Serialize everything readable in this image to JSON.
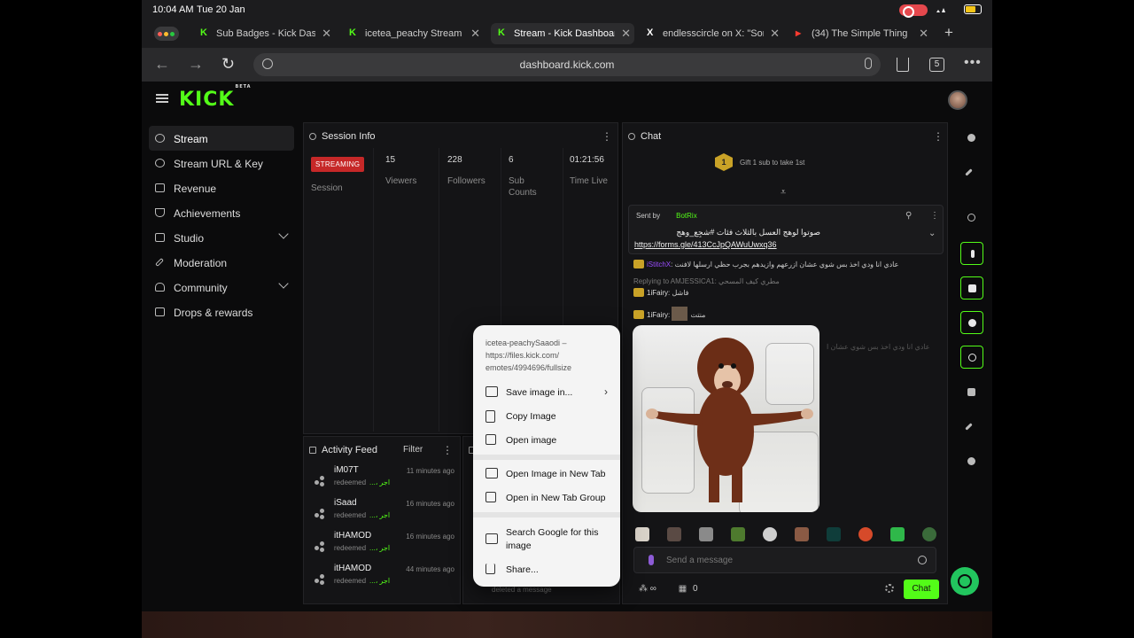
{
  "status": {
    "time": "10:04 AM",
    "date": "Tue 20 Jan"
  },
  "tabs": [
    {
      "title": "Sub Badges - Kick Dash",
      "favicon": "K"
    },
    {
      "title": "icetea_peachy Stream -",
      "favicon": "K"
    },
    {
      "title": "Stream - Kick Dashboar",
      "favicon": "K",
      "active": true
    },
    {
      "title": "endlesscircle on X: \"Sor",
      "favicon": "X"
    },
    {
      "title": "(34) The Simple Thing",
      "favicon": "▶"
    }
  ],
  "browser": {
    "url": "dashboard.kick.com",
    "tab_count": "5"
  },
  "brand": {
    "logo": "KICK",
    "beta": "BETA",
    "accent": "#53fc18"
  },
  "sidebar": {
    "items": [
      {
        "label": "Stream",
        "icon": "broadcast-icon",
        "active": true
      },
      {
        "label": "Stream URL & Key",
        "icon": "link-icon"
      },
      {
        "label": "Revenue",
        "icon": "chart-icon"
      },
      {
        "label": "Achievements",
        "icon": "trophy-icon"
      },
      {
        "label": "Studio",
        "icon": "studio-icon",
        "expandable": true
      },
      {
        "label": "Moderation",
        "icon": "wrench-icon"
      },
      {
        "label": "Community",
        "icon": "community-icon",
        "expandable": true
      },
      {
        "label": "Drops & rewards",
        "icon": "gift-icon"
      }
    ]
  },
  "session": {
    "title": "Session Info",
    "status": "STREAMING",
    "status_label": "Session",
    "stats": [
      {
        "value": "15",
        "label": "Viewers"
      },
      {
        "value": "228",
        "label": "Followers"
      },
      {
        "value": "6",
        "label": "Sub Counts"
      },
      {
        "value": "01:21:56",
        "label": "Time Live"
      }
    ]
  },
  "activity": {
    "title": "Activity Feed",
    "filter": "Filter",
    "items": [
      {
        "name": "iM07T",
        "time": "11 minutes ago",
        "action": "redeemed",
        "reward": "اجر ،‏...‏"
      },
      {
        "name": "iSaad",
        "time": "16 minutes ago",
        "action": "redeemed",
        "reward": "اجر ،‏...‏"
      },
      {
        "name": "itHAMOD",
        "time": "16 minutes ago",
        "action": "redeemed",
        "reward": "اجر ،‏...‏"
      },
      {
        "name": "itHAMOD",
        "time": "44 minutes ago",
        "action": "redeemed",
        "reward": "اجر ،‏...‏"
      }
    ]
  },
  "modlog": {
    "deleted": "deleted a message"
  },
  "chat": {
    "title": "Chat",
    "gift_text": "Gift 1 sub to take 1st",
    "gift_rank": "1",
    "pinned": {
      "sent_by": "Sent by",
      "bot": "BotRix",
      "message": "صوتوا لوهج العسل بالثلاث فئات #شجِع_وهج",
      "link": "https://forms.gle/413CcJpQAWuUwxq36"
    },
    "lines": [
      {
        "user": "iStitchX",
        "text": "عادي انا ودي اخذ بس شوي عشان ازرعهم وازيدهم بجرب حظي ارسلها لافنت"
      },
      {
        "reply": "Replying to AMJESSICA1: مطري كيف المسحي"
      },
      {
        "user": "1iFairy",
        "text": "فاشل"
      },
      {
        "user": "1iFairy",
        "text": "منتت"
      },
      {
        "faded": "عادي انا ودي اخذ بس شوي عشان ا"
      }
    ],
    "input_placeholder": "Send a message",
    "points": "∞",
    "count": "0",
    "send": "Chat"
  },
  "context_menu": {
    "header": "icetea-peachySaaodi – https://files.kick.com/ emotes/4994696/fullsize",
    "groups": [
      [
        {
          "label": "Save image in...",
          "icon": "save-image-icon",
          "submenu": true
        },
        {
          "label": "Copy Image",
          "icon": "copy-icon"
        },
        {
          "label": "Open image",
          "icon": "open-icon"
        }
      ],
      [
        {
          "label": "Open Image in New Tab",
          "icon": "new-tab-icon"
        },
        {
          "label": "Open in New Tab Group",
          "icon": "tab-group-icon"
        }
      ],
      [
        {
          "label": "Search Google for this image",
          "icon": "image-search-icon"
        },
        {
          "label": "Share...",
          "icon": "share-icon"
        }
      ]
    ]
  }
}
